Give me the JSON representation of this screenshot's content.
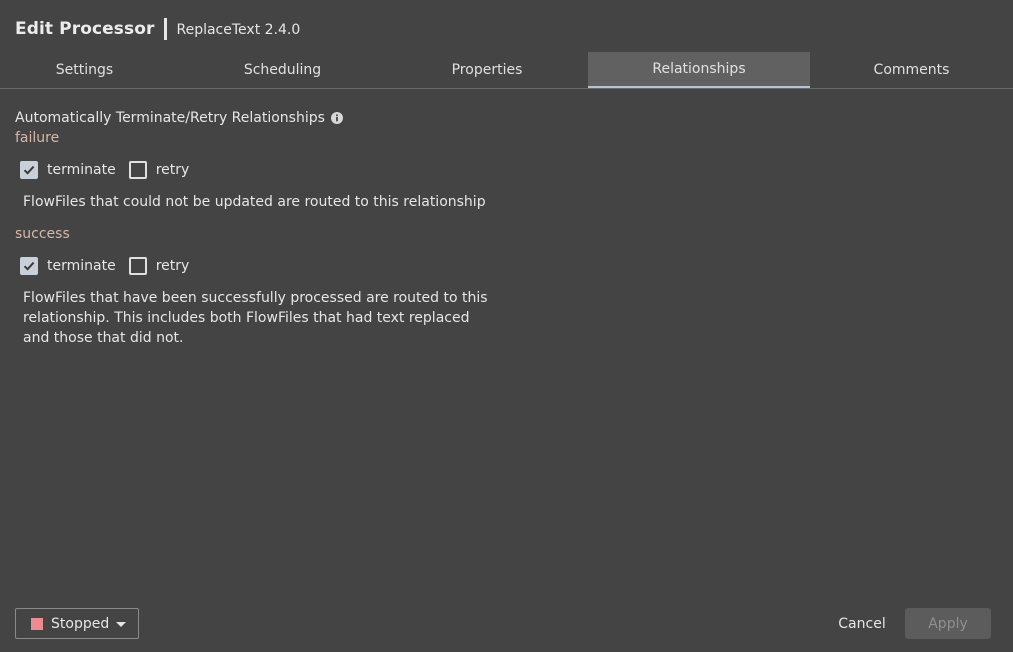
{
  "header": {
    "title": "Edit Processor",
    "subtitle": "ReplaceText 2.4.0"
  },
  "tabs": [
    {
      "label": "Settings"
    },
    {
      "label": "Scheduling"
    },
    {
      "label": "Properties"
    },
    {
      "label": "Relationships",
      "active": true
    },
    {
      "label": "Comments"
    }
  ],
  "section": {
    "title": "Automatically Terminate/Retry Relationships",
    "info_icon": "info-circle-icon"
  },
  "relationships": [
    {
      "name": "failure",
      "terminate_label": "terminate",
      "terminate_checked": true,
      "retry_label": "retry",
      "retry_checked": false,
      "description": "FlowFiles that could not be updated are routed to this relationship"
    },
    {
      "name": "success",
      "terminate_label": "terminate",
      "terminate_checked": true,
      "retry_label": "retry",
      "retry_checked": false,
      "description": "FlowFiles that have been successfully processed are routed to this relationship. This includes both FlowFiles that had text replaced and those that did not."
    }
  ],
  "footer": {
    "state_label": "Stopped",
    "state_color": "#f08a8f",
    "cancel_label": "Cancel",
    "apply_label": "Apply"
  },
  "colors": {
    "background": "#444444",
    "active_tab": "#616161",
    "relationship_name": "#d6b8a6"
  }
}
